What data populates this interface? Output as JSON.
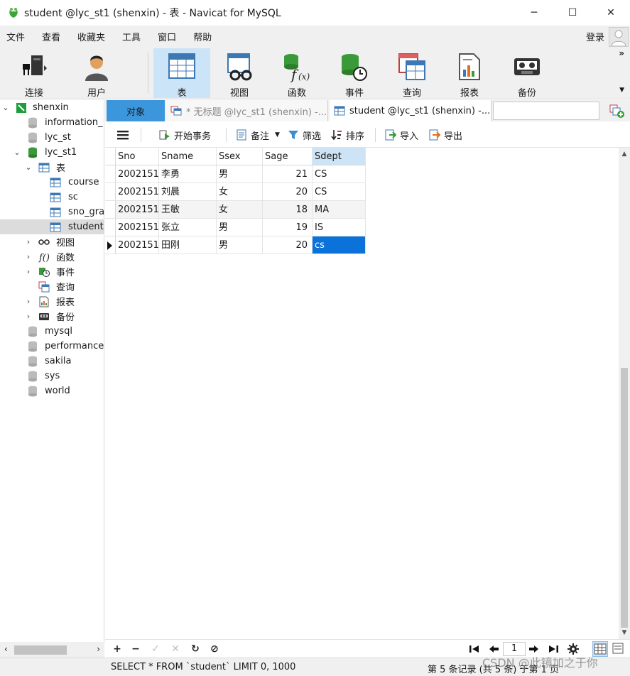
{
  "window": {
    "title": "student @lyc_st1 (shenxin) - 表 - Navicat for MySQL",
    "minimize": "─",
    "maximize": "☐",
    "close": "✕"
  },
  "menu": [
    "文件",
    "查看",
    "收藏夹",
    "工具",
    "窗口",
    "帮助"
  ],
  "login_label": "登录",
  "toolbar": [
    {
      "label": "连接",
      "icon": "connection-icon"
    },
    {
      "label": "用户",
      "icon": "user-icon"
    },
    {
      "label": "表",
      "icon": "table-icon"
    },
    {
      "label": "视图",
      "icon": "view-icon"
    },
    {
      "label": "函数",
      "icon": "function-icon"
    },
    {
      "label": "事件",
      "icon": "event-icon"
    },
    {
      "label": "查询",
      "icon": "query-icon"
    },
    {
      "label": "报表",
      "icon": "report-icon"
    },
    {
      "label": "备份",
      "icon": "backup-icon"
    }
  ],
  "active_toolbar": "表",
  "nav": {
    "connection": "shenxin",
    "items": [
      "information_",
      "lyc_st",
      "lyc_st1",
      "表",
      "course",
      "sc",
      "sno_gra",
      "student",
      "视图",
      "函数",
      "事件",
      "查询",
      "报表",
      "备份",
      "mysql",
      "performance",
      "sakila",
      "sys",
      "world"
    ],
    "selected": "student"
  },
  "tabs": {
    "objects": "对象",
    "tab1": "* 无标题 @lyc_st1 (shenxin) -...",
    "tab2": "student @lyc_st1 (shenxin) -..."
  },
  "data_toolbar": {
    "begin_tx": "开始事务",
    "note": "备注",
    "filter": "筛选",
    "sort": "排序",
    "import": "导入",
    "export": "导出"
  },
  "grid": {
    "columns": [
      "Sno",
      "Sname",
      "Ssex",
      "Sage",
      "Sdept"
    ],
    "highlighted_column": "Sdept",
    "rows": [
      [
        "2002151",
        "李勇",
        "男",
        "21",
        "CS"
      ],
      [
        "2002151",
        "刘晨",
        "女",
        "20",
        "CS"
      ],
      [
        "2002151",
        "王敏",
        "女",
        "18",
        "MA"
      ],
      [
        "2002151",
        "张立",
        "男",
        "19",
        "IS"
      ],
      [
        "2002151",
        "田刚",
        "男",
        "20",
        "cs"
      ]
    ],
    "current_row": 4,
    "editing_cell": "cs"
  },
  "bottom": {
    "add": "+",
    "remove": "−",
    "apply": "✓",
    "discard": "✕",
    "refresh": "↻",
    "stop": "⊘",
    "page": "1"
  },
  "status": {
    "sql": "SELECT * FROM `student` LIMIT 0, 1000",
    "record": "第 5 条记录 (共 5 条) 于第 1 页"
  },
  "watermark": "CSDN @此镜加之于你",
  "colors": {
    "accent": "#3c96dc",
    "selected_cell": "#0a72d8",
    "active_tool": "#cce4f7"
  }
}
